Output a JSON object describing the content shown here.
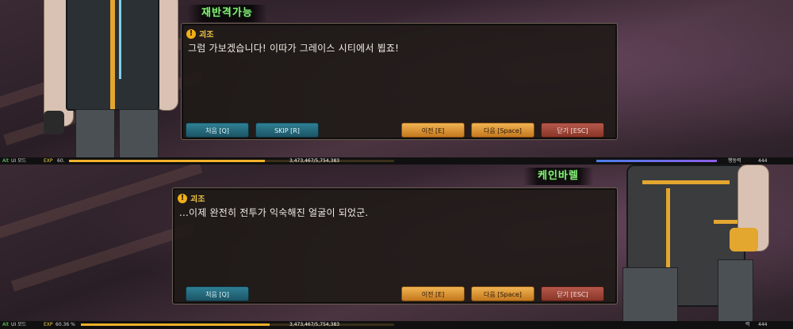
{
  "panels": [
    {
      "name_tag": "재반격가능",
      "speaker": "괴조",
      "line": "그럼 가보겠습니다! 이따가 그레이스 시티에서 뵙죠!",
      "buttons": {
        "first": "처음 [Q]",
        "skip": "SKIP [R]",
        "prev": "이전 [E]",
        "next": "다음 [Space]",
        "close": "닫기 [ESC]"
      },
      "hud": {
        "alt": "Alt",
        "ui_mode": "UI 모드",
        "exp_label": "EXP",
        "exp_pct": "60.",
        "exp_value": "3,473,467/5,754,383",
        "exp_fraction": 0.6036,
        "stat_label": "행동력",
        "stat_value": "444"
      }
    },
    {
      "name_tag": "케인바렐",
      "speaker": "괴조",
      "line": "...이제 완전히 전투가 익숙해진 얼굴이 되었군.",
      "buttons": {
        "first": "처음 [Q]",
        "prev": "이전 [E]",
        "next": "다음 [Space]",
        "close": "닫기 [ESC]"
      },
      "hud": {
        "alt": "Alt",
        "ui_mode": "UI 모드",
        "exp_label": "EXP",
        "exp_pct": "60.36 %",
        "exp_value": "3,473,467/5,754,383",
        "exp_fraction": 0.6036,
        "stat_label": "력",
        "stat_value": "444"
      }
    }
  ],
  "colors": {
    "name_tag": "#8af27c",
    "speaker": "#f2c94a",
    "teal_button": "#2f7f94",
    "gold_button": "#e9a547",
    "red_button": "#a64a3c"
  },
  "icons": {
    "speaker_icon": "warning-icon"
  }
}
